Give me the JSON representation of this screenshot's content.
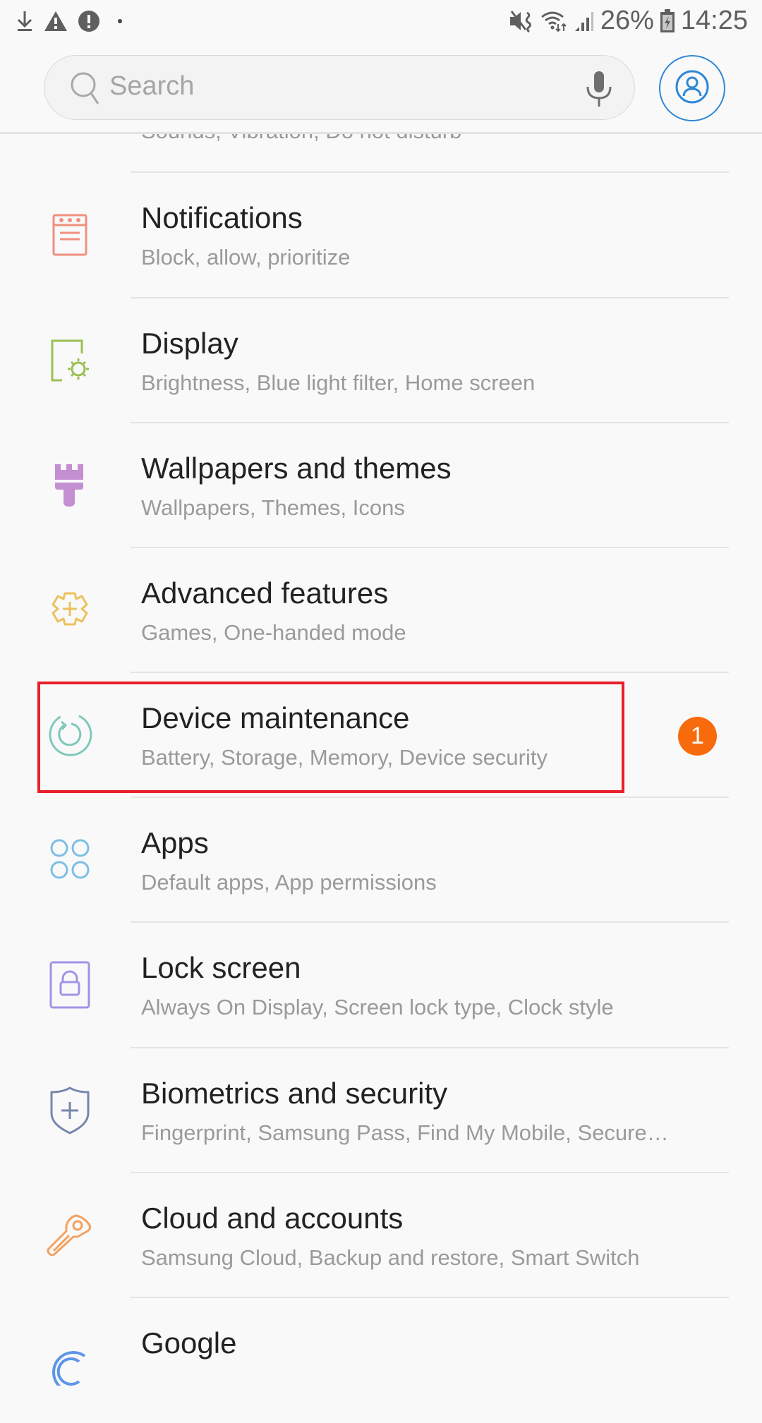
{
  "status_bar": {
    "left_icons": [
      "download-icon",
      "warning-icon",
      "alert-icon",
      "dot-icon"
    ],
    "right_icons": [
      "vibrate-mute-icon",
      "wifi-icon",
      "signal-icon",
      "battery-charging-icon"
    ],
    "battery": "26%",
    "time": "14:25"
  },
  "header": {
    "search_placeholder": "Search",
    "search_icon": "search-icon",
    "mic_icon": "mic-icon",
    "profile_icon": "profile-icon",
    "accent_color": "#2e87d5"
  },
  "partial_item": {
    "subtitle": "Sounds, Vibration, Do not disturb"
  },
  "items": [
    {
      "title": "Notifications",
      "subtitle": "Block, allow, prioritize",
      "icon": "notifications-icon",
      "color": "#f0907f"
    },
    {
      "title": "Display",
      "subtitle": "Brightness, Blue light filter, Home screen",
      "icon": "display-icon",
      "color": "#9bc053"
    },
    {
      "title": "Wallpapers and themes",
      "subtitle": "Wallpapers, Themes, Icons",
      "icon": "paintbrush-icon",
      "color": "#c48fd0"
    },
    {
      "title": "Advanced features",
      "subtitle": "Games, One-handed mode",
      "icon": "gear-plus-icon",
      "color": "#ecc15c"
    },
    {
      "title": "Device maintenance",
      "subtitle": "Battery, Storage, Memory, Device security",
      "icon": "device-maintenance-icon",
      "color": "#7fc9b9",
      "badge": "1",
      "highlighted": true
    },
    {
      "title": "Apps",
      "subtitle": "Default apps, App permissions",
      "icon": "apps-icon",
      "color": "#7cbfe2"
    },
    {
      "title": "Lock screen",
      "subtitle": "Always On Display, Screen lock type, Clock style",
      "icon": "lock-icon",
      "color": "#a392e6"
    },
    {
      "title": "Biometrics and security",
      "subtitle": "Fingerprint, Samsung Pass, Find My Mobile, Secure…",
      "icon": "shield-icon",
      "color": "#7786ad"
    },
    {
      "title": "Cloud and accounts",
      "subtitle": "Samsung Cloud, Backup and restore, Smart Switch",
      "icon": "key-icon",
      "color": "#f3a25f"
    },
    {
      "title": "Google",
      "subtitle": "",
      "icon": "google-icon",
      "color": "#5e96e6"
    }
  ],
  "badge_color": "#f76b0d",
  "highlight_color": "#e8202a"
}
